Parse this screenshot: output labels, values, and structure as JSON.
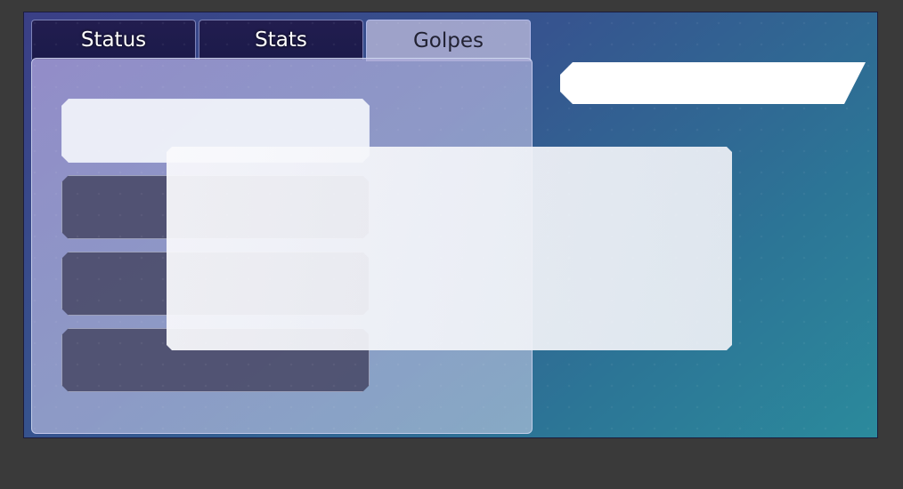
{
  "tabs": [
    {
      "label": "Status",
      "active": false
    },
    {
      "label": "Stats",
      "active": false
    },
    {
      "label": "Golpes",
      "active": true
    }
  ],
  "colors": {
    "background": "#3a3a3a",
    "tab_inactive": "#1e1b4d",
    "panel": "#b4b0d8",
    "accent_light": "#f0f2fa",
    "accent_dark": "#46466a"
  }
}
